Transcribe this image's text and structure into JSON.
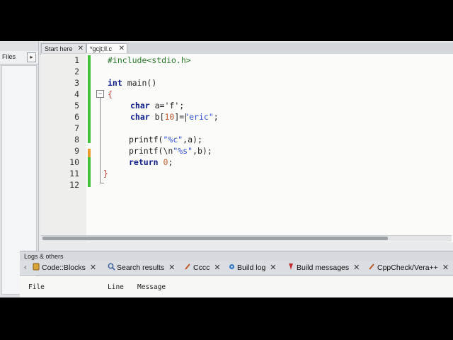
{
  "side_panel": {
    "tab_label": "Files",
    "tab_arrow": "▸"
  },
  "editor_tabs": [
    {
      "label": "Start here",
      "close": "✕"
    },
    {
      "label": "*gcjt;ll.c",
      "close": "✕"
    }
  ],
  "code_lines": [
    {
      "num": "1"
    },
    {
      "num": "2"
    },
    {
      "num": "3"
    },
    {
      "num": "4"
    },
    {
      "num": "5"
    },
    {
      "num": "6"
    },
    {
      "num": "7"
    },
    {
      "num": "8"
    },
    {
      "num": "9"
    },
    {
      "num": "10"
    },
    {
      "num": "11"
    },
    {
      "num": "12"
    }
  ],
  "code": {
    "l1": "#include<stdio.h>",
    "l3_kw": "int",
    "l3_rest": " main()",
    "l4": "{",
    "l5_kw": "char",
    "l5_rest": " a='f';",
    "l6_kw": "char",
    "l6_a": " b[",
    "l6_num": "10",
    "l6_b": "]=",
    "l6_str": "\"eric\"",
    "l6_c": ";",
    "l8_a": "printf(",
    "l8_str": "\"%c\"",
    "l8_b": ",a);",
    "l9_a": "printf(\\n",
    "l9_str": "\"%s\"",
    "l9_b": ",b);",
    "l10_kw": "return",
    "l10_num": " 0",
    "l10_b": ";",
    "l11": "}"
  },
  "logs": {
    "header": "Logs & others",
    "tabs": [
      {
        "label": "Code::Blocks",
        "icon": "code-blocks-icon"
      },
      {
        "label": "Search results",
        "icon": "search-icon"
      },
      {
        "label": "Cccc",
        "icon": "pencil-icon"
      },
      {
        "label": "Build log",
        "icon": "gear-icon"
      },
      {
        "label": "Build messages",
        "icon": "pin-icon"
      },
      {
        "label": "CppCheck/Vera++",
        "icon": "pencil-icon"
      }
    ],
    "close": "✕",
    "prev_arrow": "‹",
    "next_arrow": "›",
    "columns": [
      "File",
      "Line",
      "Message"
    ]
  },
  "colors": {
    "added_line": "#42c23a",
    "modified_line": "#e89a2a",
    "keyword": "#0b1b8a",
    "string": "#2c4fd1"
  }
}
